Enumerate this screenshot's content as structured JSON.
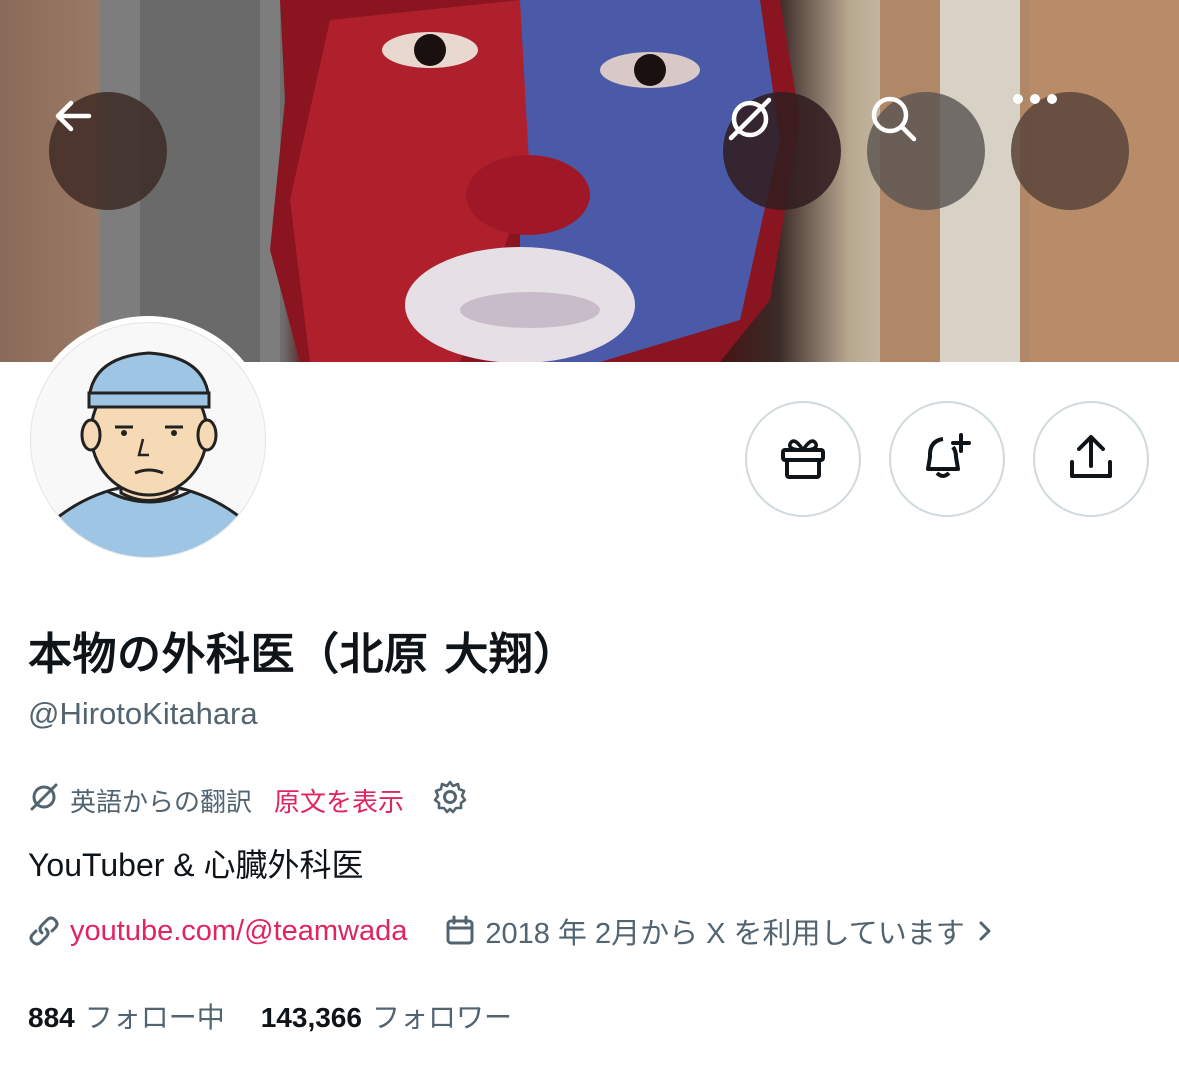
{
  "profile": {
    "display_name": "本物の外科医（北原 大翔）",
    "handle": "@HirotoKitahara",
    "translation_note": "英語からの翻訳",
    "show_original": "原文を表示",
    "bio": "YouTuber & 心臓外科医",
    "website": "youtube.com/@teamwada",
    "joined": "2018 年 2月から X を利用しています"
  },
  "stats": {
    "following_count": "884",
    "following_label": "フォロー中",
    "followers_count": "143,366",
    "followers_label": "フォロワー"
  },
  "icons": {
    "back": "back-arrow-icon",
    "grok": "grok-icon",
    "search": "search-icon",
    "more": "more-icon",
    "gift": "gift-icon",
    "notify": "bell-plus-icon",
    "share": "share-icon",
    "translate": "translate-icon",
    "settings": "gear-icon",
    "link": "link-icon",
    "calendar": "calendar-icon",
    "chevron": "chevron-right-icon"
  },
  "colors": {
    "accent_link": "#e0245e",
    "secondary_text": "#536471",
    "primary_text": "#0f1419",
    "button_border": "#cfd9de"
  }
}
